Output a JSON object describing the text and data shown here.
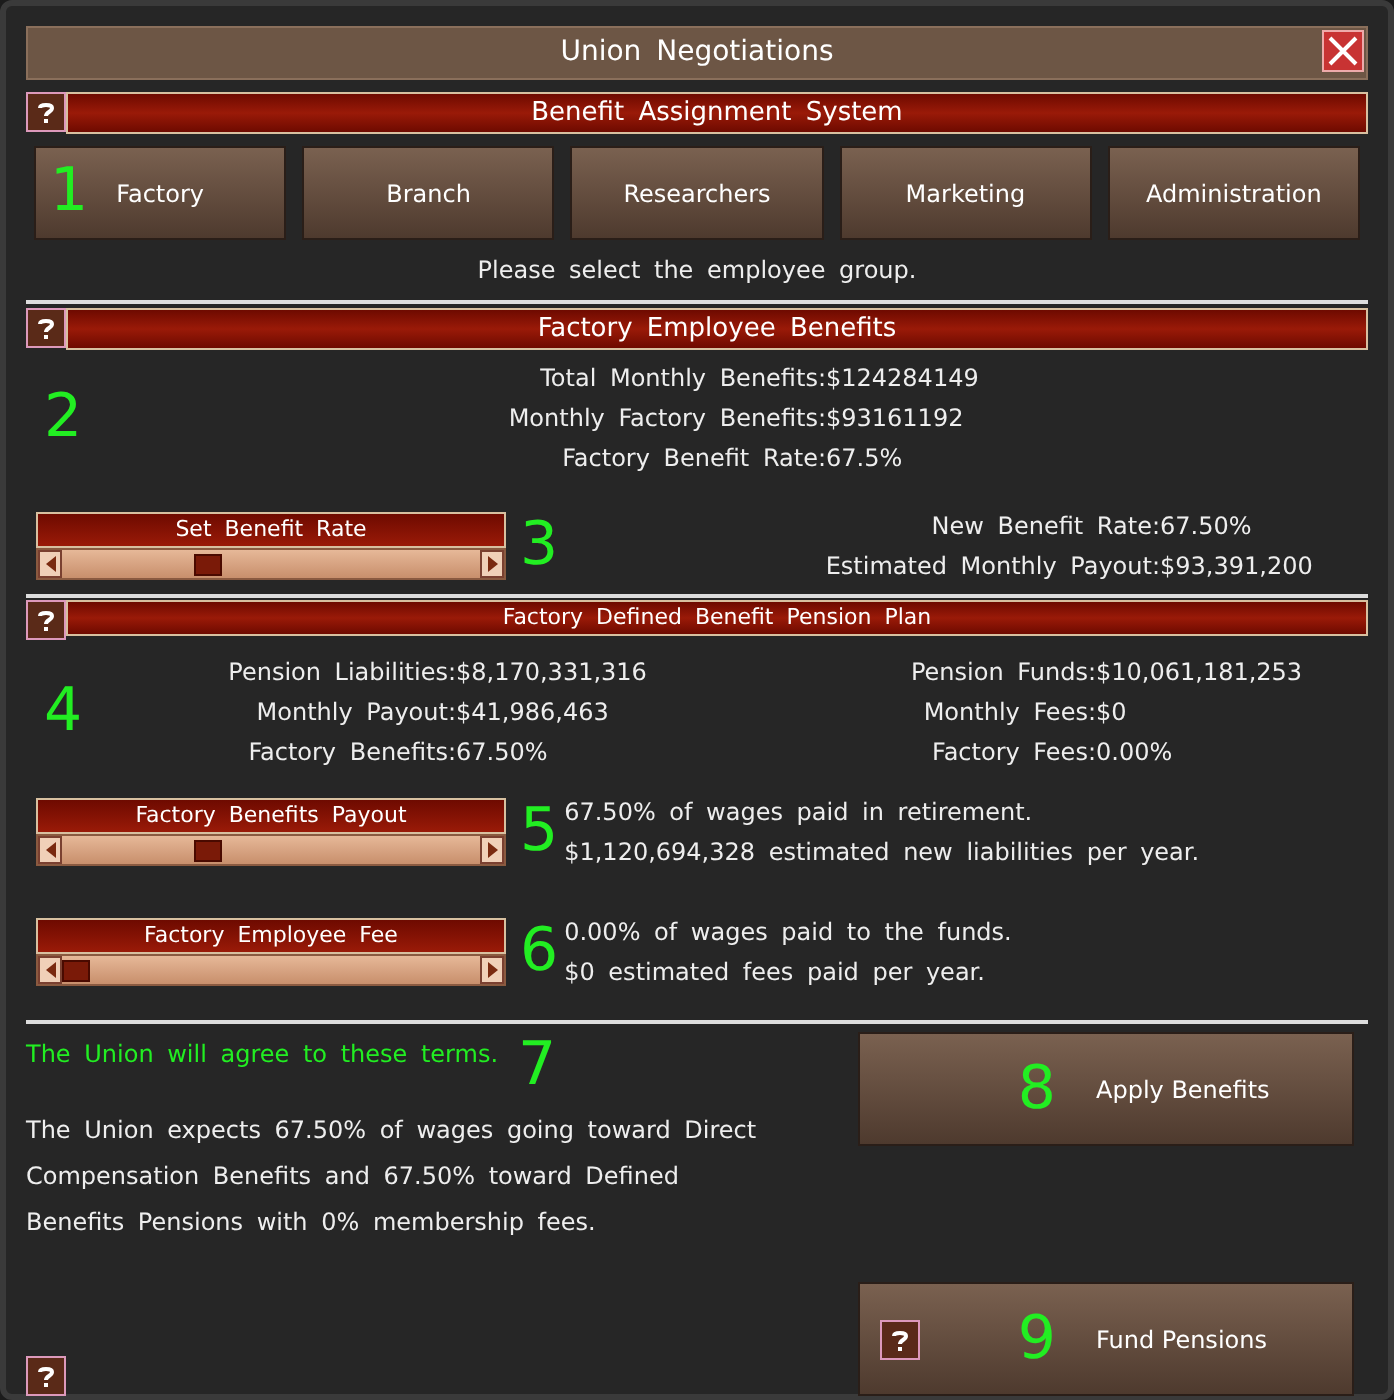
{
  "window": {
    "title": "Union Negotiations"
  },
  "assignment": {
    "title": "Benefit Assignment System",
    "marker": "1",
    "groups": [
      {
        "label": "Factory"
      },
      {
        "label": "Branch"
      },
      {
        "label": "Researchers"
      },
      {
        "label": "Marketing"
      },
      {
        "label": "Administration"
      }
    ],
    "hint": "Please select the employee group."
  },
  "benefits": {
    "title": "Factory Employee Benefits",
    "marker": "2",
    "stats": [
      {
        "label": "Total Monthly Benefits:",
        "value": "$124284149"
      },
      {
        "label": "Monthly Factory Benefits:",
        "value": "$93161192"
      },
      {
        "label": "Factory Benefit Rate:",
        "value": "67.5%"
      }
    ],
    "slider": {
      "label": "Set Benefit Rate",
      "level": 0.34,
      "marker": "3"
    },
    "results": [
      {
        "label": "New Benefit Rate:",
        "value": "67.50%"
      },
      {
        "label": "Estimated Monthly Payout:",
        "value": "$93,391,200"
      }
    ]
  },
  "pension": {
    "title": "Factory Defined Benefit Pension Plan",
    "marker": "4",
    "left_stats": [
      {
        "label": "Pension Liabilities:",
        "value": "$8,170,331,316"
      },
      {
        "label": "Monthly Payout:",
        "value": "$41,986,463"
      },
      {
        "label": "Factory Benefits:",
        "value": "67.50%"
      }
    ],
    "right_stats": [
      {
        "label": "Pension Funds:",
        "value": "$10,061,181,253"
      },
      {
        "label": "Monthly Fees:",
        "value": "$0"
      },
      {
        "label": "Factory Fees:",
        "value": "0.00%"
      }
    ],
    "sliders": [
      {
        "label": "Factory Benefits Payout",
        "level": 0.34,
        "marker": "5",
        "lines": [
          "67.50% of wages paid in retirement.",
          "$1,120,694,328 estimated new liabilities per year."
        ]
      },
      {
        "label": "Factory Employee Fee",
        "marker": "6",
        "lines": [
          "0.00% of wages paid to the funds.",
          "$0 estimated fees paid per year."
        ]
      }
    ]
  },
  "terms": {
    "status": "The Union will agree to these terms.",
    "marker": "7",
    "text": "The Union expects 67.50% of wages going toward Direct Compensation Benefits and 67.50% toward Defined Benefits Pensions with 0% membership fees."
  },
  "actions": [
    {
      "label": "Apply Benefits",
      "marker": "8",
      "help_icon": false
    },
    {
      "label": "Fund Pensions",
      "marker": "9",
      "help_icon": true
    }
  ]
}
